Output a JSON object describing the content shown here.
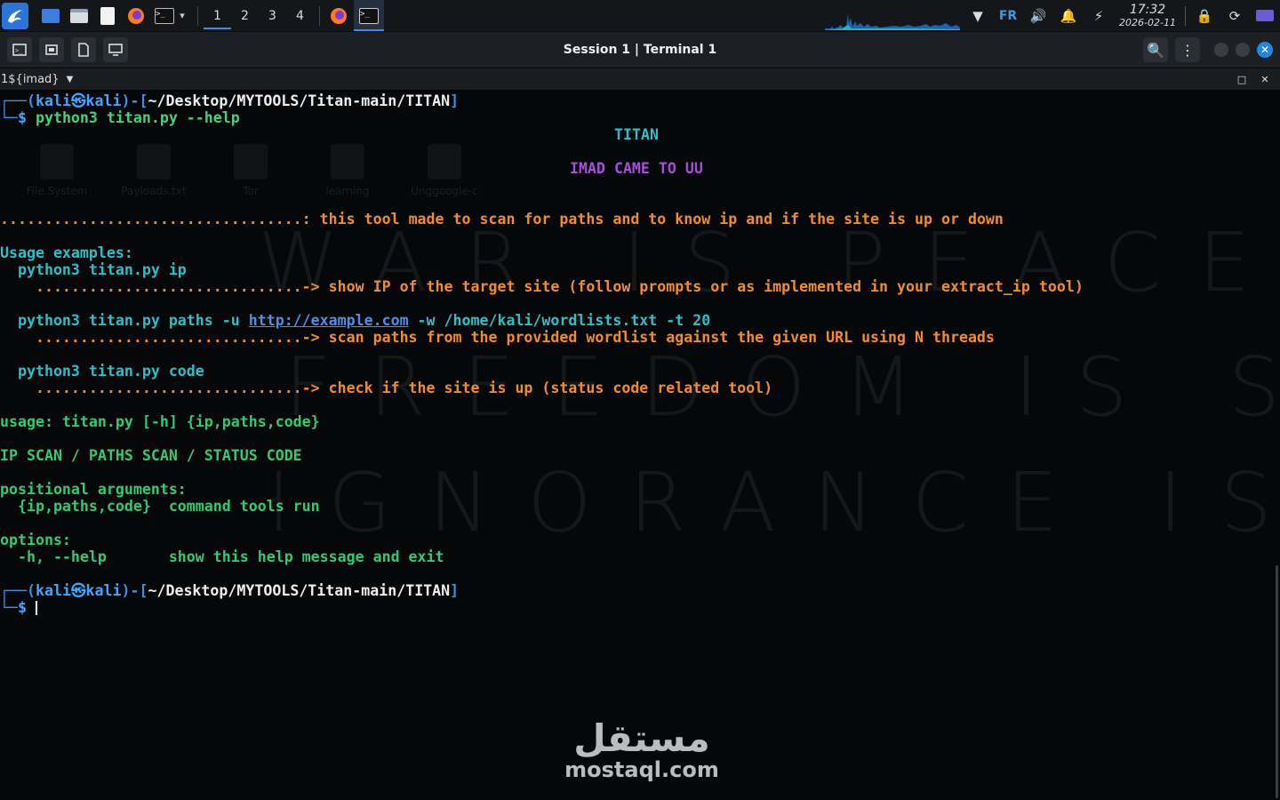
{
  "taskbar": {
    "workspaces": [
      "1",
      "2",
      "3",
      "4"
    ],
    "active_workspace": "1",
    "lang": "FR",
    "time": "17:32",
    "date": "2026-02-11",
    "icons": [
      "kali-menu-icon",
      "desktop-icon",
      "file-manager-icon",
      "text-editor-icon",
      "firefox-icon",
      "terminal-icon",
      "chevron-down-icon",
      "network-icon",
      "volume-icon",
      "notification-bell-icon",
      "power-icon",
      "lock-icon",
      "refresh-icon",
      "display-icon"
    ]
  },
  "titlebar": {
    "title": "Session 1 | Terminal 1"
  },
  "tabbar": {
    "label": "1${imad}"
  },
  "terminal": {
    "prompt_user": "kali",
    "prompt_host": "kali",
    "prompt_path": "~/Desktop/MYTOOLS/Titan-main/TITAN",
    "command": "python3 titan.py --help",
    "banner_title": "TITAN",
    "banner_sub": "IMAD CAME TO UU",
    "desc_dots": "..................................:",
    "desc": " this tool made to scan for paths and to know ip and if the site is up or down",
    "usage_examples": "Usage examples:",
    "ex1_cmd": "  python3 titan.py ip",
    "ex1_dots": "    ..............................->",
    "ex1_desc": " show IP of the target site (follow prompts or as implemented in your extract_ip tool)",
    "ex2_cmd_a": "  python3 titan.py paths -u ",
    "ex2_url": "http://example.com",
    "ex2_cmd_b": " -w /home/kali/wordlists.txt -t 20",
    "ex2_dots": "    ..............................->",
    "ex2_desc": " scan paths from the provided wordlist against the given URL using N threads",
    "ex3_cmd": "  python3 titan.py code",
    "ex3_dots": "    ..............................->",
    "ex3_desc": " check if the site is up (status code related tool)",
    "usage": "usage: titan.py [-h] {ip,paths,code}",
    "headline": "IP SCAN / PATHS SCAN / STATUS CODE",
    "positional": "positional arguments:",
    "pos_arg": "  {ip,paths,code}  command tools run",
    "options": "options:",
    "opt_help": "  -h, --help       show this help message and exit",
    "prompt2_cmd": ""
  },
  "background": {
    "slogan1": "WAR IS PEACE",
    "slogan2": "FREEDOM IS SLAVERY",
    "slogan3": "IGNORANCE IS POWER",
    "desktop_icons": [
      "File System",
      "Payloads.txt",
      "Tor",
      "learning",
      "Unggoogle-c"
    ]
  },
  "watermark": {
    "arabic": "مستقل",
    "latin": "mostaql.com"
  },
  "colors": {
    "accent": "#3b8fe6",
    "prompt_green": "#2ecc71",
    "output_orange": "#f28c28",
    "banner_cyan": "#2bc0c9",
    "banner_purple": "#a54fd8"
  }
}
